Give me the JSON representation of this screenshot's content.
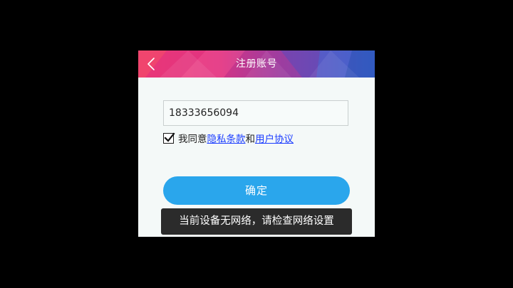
{
  "header": {
    "title": "注册账号",
    "back_icon": "chevron-left-icon"
  },
  "form": {
    "phone_value": "18333656094",
    "agree_checked": true,
    "agree_prefix": "我同意",
    "privacy_link": "隐私条款",
    "connector": "和",
    "user_agreement_link": "用户协议",
    "confirm_label": "确定"
  },
  "toast": {
    "message": "当前设备无网络，请检查网络设置"
  },
  "colors": {
    "header_pink": "#e8337a",
    "header_blue": "#3b5cc4",
    "confirm_button": "#2aa6ec",
    "link": "#1a3cff",
    "toast_bg": "#2b2b2b"
  }
}
